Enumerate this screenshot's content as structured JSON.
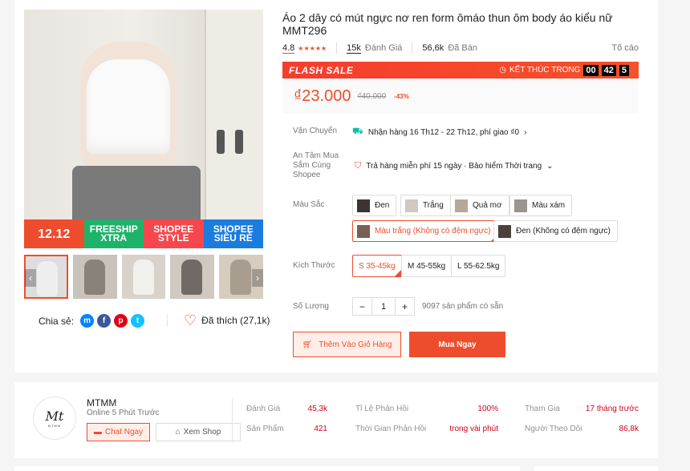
{
  "product": {
    "title": "Áo 2 dây có mút ngực nơ ren form ômáo thun ôm body áo kiểu nữ MMT296",
    "rating_value": "4.8",
    "stars": "★★★★★",
    "rating_count": "15k",
    "rating_label": "Đánh Giá",
    "sold_count": "56,6k",
    "sold_label": "Đã Bán",
    "report": "Tố cáo"
  },
  "banner": {
    "b1": "12.12",
    "b2": "FREESHIP XTRA",
    "b3": "SHOPEE STYLE",
    "b4": "SHOPEE SIÊU RẺ"
  },
  "flash_sale": {
    "label": "FLASH SALE",
    "ends_label": "KẾT THÚC TRONG",
    "hh": "00",
    "mm": "42",
    "ss": "5"
  },
  "price": {
    "current": "₫23.000",
    "original": "₫40.000",
    "discount": "-43%"
  },
  "shipping": {
    "label": "Vận Chuyển",
    "value": "Nhận hàng 16 Th12 - 22 Th12, phí giao ₫0",
    "icon": "truck-icon"
  },
  "guarantee": {
    "label": "An Tâm Mua Sắm Cùng Shopee",
    "value": "Trả hàng miễn phí 15 ngày · Bảo hiểm Thời trang",
    "icon": "shield-icon"
  },
  "colors": {
    "label": "Màu Sắc",
    "options": [
      {
        "label": "Đen",
        "swatch": "#3a3532"
      },
      {
        "label": "Trắng",
        "swatch": "#cfc9c2"
      },
      {
        "label": "Quả mơ",
        "swatch": "#b5a89b"
      },
      {
        "label": "Màu xám",
        "swatch": "#9a958f"
      },
      {
        "label": "Màu trắng (Không có đệm ngực)",
        "swatch": "#7b5f55"
      },
      {
        "label": "Đen (Không có đệm ngực)",
        "swatch": "#4a403c"
      }
    ]
  },
  "sizes": {
    "label": "Kích Thước",
    "options": [
      "S 35-45kg",
      "M 45-55kg",
      "L 55-62.5kg"
    ]
  },
  "quantity": {
    "label": "Số Lượng",
    "minus": "−",
    "value": "1",
    "plus": "+",
    "available": "9097 sản phẩm có sẵn"
  },
  "actions": {
    "add_to_cart": "Thêm Vào Giỏ Hàng",
    "buy_now": "Mua Ngay"
  },
  "share": {
    "label": "Chia sẻ:",
    "like": "Đã thích (27,1k)"
  },
  "shop": {
    "name": "MTMM",
    "online": "Online 5 Phút Trước",
    "logo_text": "Mt",
    "logo_sub": "MTMM",
    "chat": "Chat Ngay",
    "view": "Xem Shop",
    "stats": {
      "ratings_label": "Đánh Giá",
      "ratings_value": "45,3k",
      "products_label": "Sản Phẩm",
      "products_value": "421",
      "response_rate_label": "Tỉ Lệ Phản Hồi",
      "response_rate_value": "100%",
      "response_time_label": "Thời Gian Phản Hồi",
      "response_time_value": "trong vài phút",
      "joined_label": "Tham Gia",
      "joined_value": "17 tháng trước",
      "followers_label": "Người Theo Dõi",
      "followers_value": "86,8k"
    }
  },
  "colors_theme": {
    "accent": "#ee4d2d",
    "flash": "#f53d2d"
  }
}
